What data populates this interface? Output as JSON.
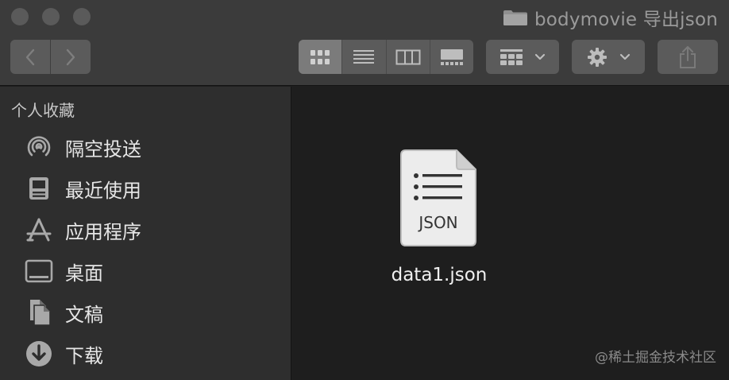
{
  "window": {
    "title": "bodymovie 导出json"
  },
  "toolbar": {
    "view_modes": [
      "icon-view",
      "list-view",
      "column-view",
      "gallery-view"
    ],
    "active_view": "icon-view"
  },
  "sidebar": {
    "header": "个人收藏",
    "items": [
      {
        "label": "隔空投送",
        "icon": "airdrop-icon"
      },
      {
        "label": "最近使用",
        "icon": "recents-icon"
      },
      {
        "label": "应用程序",
        "icon": "applications-icon"
      },
      {
        "label": "桌面",
        "icon": "desktop-icon"
      },
      {
        "label": "文稿",
        "icon": "documents-icon"
      },
      {
        "label": "下载",
        "icon": "downloads-icon"
      }
    ]
  },
  "content": {
    "files": [
      {
        "name": "data1.json",
        "icon": "json-file-icon",
        "badge": "JSON"
      }
    ]
  },
  "watermark": "@稀土掘金技术社区",
  "colors": {
    "titlebar": "#3b3b3b",
    "sidebar": "#2e2e2e",
    "content": "#1e1e1e",
    "button": "#5b5b5b",
    "active_segment": "#7b7b7b"
  }
}
